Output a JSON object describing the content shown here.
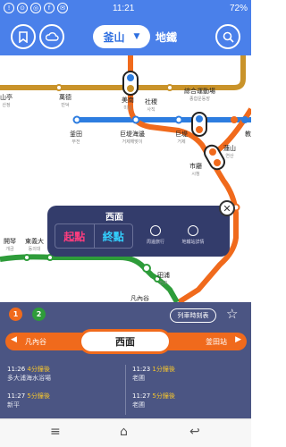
{
  "status": {
    "time": "11:21",
    "battery": "72%"
  },
  "header": {
    "city": "釜山",
    "mode_label": "地鐵"
  },
  "map_labels": [
    {
      "zh": "西面",
      "ko": ""
    },
    {
      "zh": "山亭",
      "ko": "산정"
    },
    {
      "zh": "萬德",
      "ko": "만덕"
    },
    {
      "zh": "美南",
      "ko": "미남"
    },
    {
      "zh": "社稷",
      "ko": "사직"
    },
    {
      "zh": "綜合運動場",
      "ko": "종합운동장"
    },
    {
      "zh": "釜田",
      "ko": "부전"
    },
    {
      "zh": "巨堤海邊",
      "ko": "거제해맞이"
    },
    {
      "zh": "巨堤",
      "ko": "거제"
    },
    {
      "zh": "教",
      "ko": ""
    },
    {
      "zh": "蓮山",
      "ko": "연산"
    },
    {
      "zh": "市廳",
      "ko": "시청"
    },
    {
      "zh": "開琴",
      "ko": "개금"
    },
    {
      "zh": "東義大",
      "ko": "동의대"
    },
    {
      "zh": "田浦",
      "ko": "전포"
    },
    {
      "zh": "凡內谷",
      "ko": ""
    }
  ],
  "popup": {
    "station": "西面",
    "departure": "起點",
    "arrival": "終點",
    "nearby": "周邊旅行",
    "info": "地鐵站詳情"
  },
  "panel": {
    "lines": [
      "1",
      "2"
    ],
    "timetable": "列車時刻表",
    "prev_station": "凡內谷",
    "current_station": "西面",
    "next_station": "釜田站",
    "arrivals": [
      {
        "time": "11:26",
        "minutes": "4分鐘後",
        "dest": "多大浦海水浴場"
      },
      {
        "time": "11:23",
        "minutes": "1分鐘後",
        "dest": "老圃"
      },
      {
        "time": "11:27",
        "minutes": "5分鐘後",
        "dest": "新平"
      },
      {
        "time": "11:27",
        "minutes": "5分鐘後",
        "dest": "老圃"
      }
    ]
  },
  "colors": {
    "header_blue": "#4a80ea",
    "line1_orange": "#f06a1c",
    "line2_green": "#2e9c3a",
    "line4_blue": "#2d7de0",
    "line3_brown": "#c9932a",
    "panel_navy": "#4b5583",
    "popup_navy": "#333c6b"
  },
  "icons": [
    "bookmark-icon",
    "weather-icon",
    "search-icon",
    "location-pin-icon",
    "info-search-icon",
    "close-icon",
    "star-icon",
    "menu-icon",
    "home-icon",
    "back-icon"
  ]
}
